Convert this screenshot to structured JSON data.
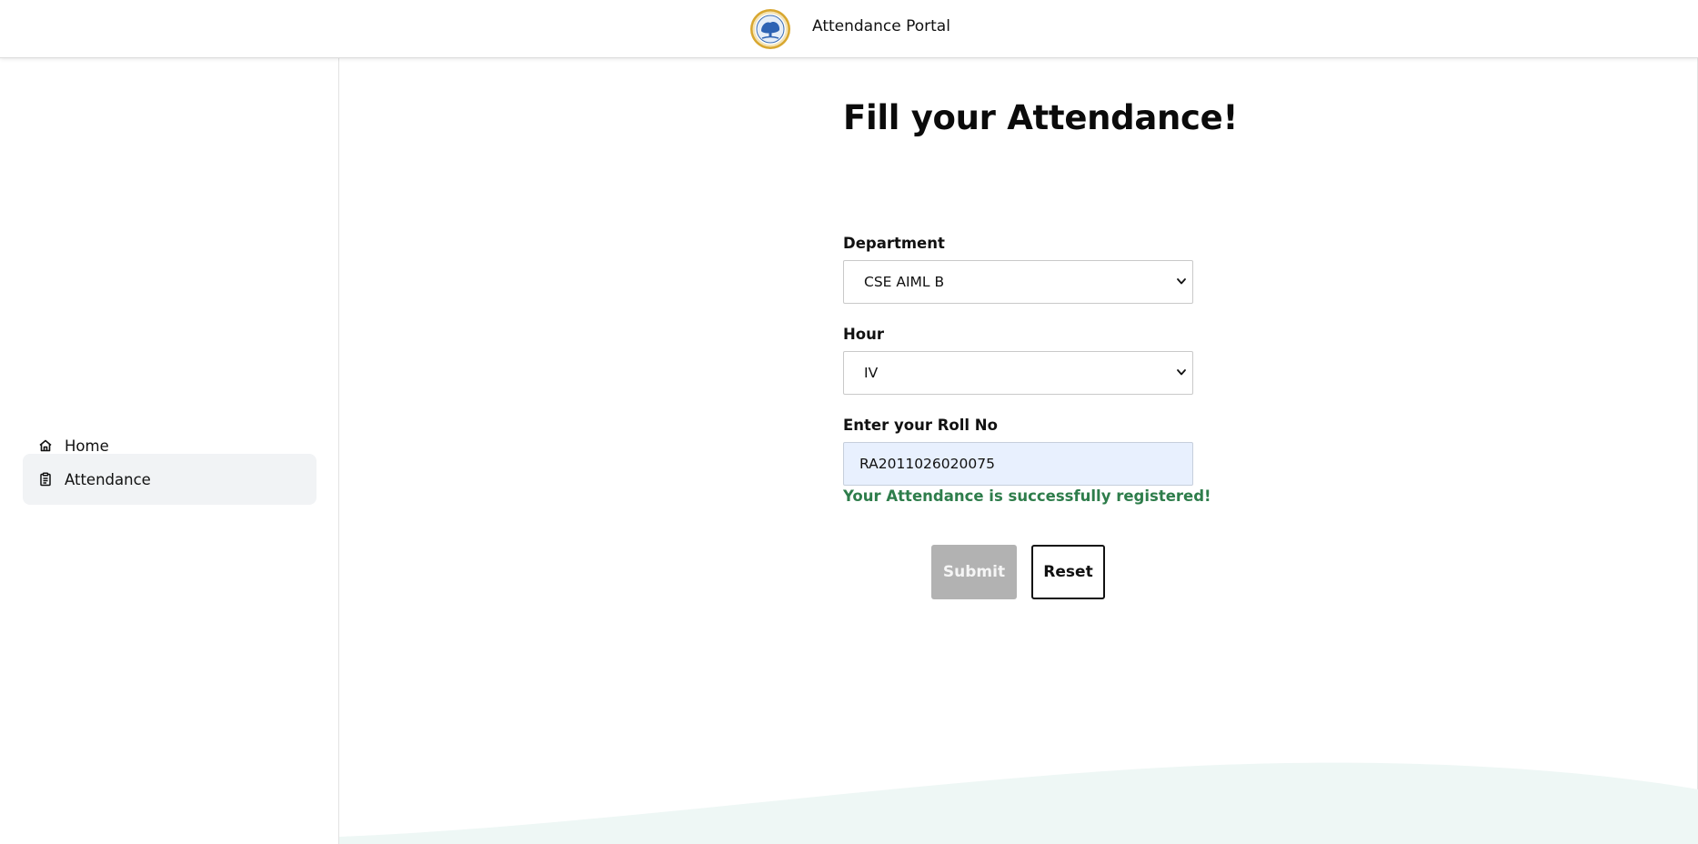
{
  "header": {
    "app_title": "Attendance Portal",
    "logo_icon": "institution-seal-icon"
  },
  "sidebar": {
    "items": [
      {
        "label": "Home",
        "icon": "home-icon",
        "active": false
      },
      {
        "label": "Attendance",
        "icon": "clipboard-icon",
        "active": true
      }
    ]
  },
  "form": {
    "title": "Fill your Attendance!",
    "department": {
      "label": "Department",
      "selected": "CSE AIML B"
    },
    "hour": {
      "label": "Hour",
      "selected": "IV"
    },
    "roll_no": {
      "label": "Enter your Roll No",
      "value": "RA2011026020075"
    },
    "success_message": "Your Attendance is successfully registered!",
    "submit_label": "Submit",
    "reset_label": "Reset"
  },
  "colors": {
    "success": "#2e7d4b",
    "submit_disabled": "#b2b2b2",
    "active_nav_bg": "#f1f3f5",
    "input_autofill_bg": "#e8f0fe",
    "wave": "#eef7f5"
  }
}
